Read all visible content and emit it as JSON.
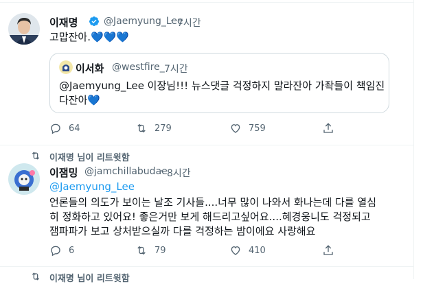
{
  "tweet1": {
    "name": "이재명",
    "handle": "@Jaemyung_Lee",
    "dot": "·",
    "time": "7시간",
    "text": "고맙잔아.💙💙💙",
    "quote": {
      "name": "이서화",
      "handle": "@westfire_",
      "dot": "·",
      "time": "7시간",
      "line1": "@Jaemyung_Lee 이장님!!! 뉴스댓글 걱정하지 말라잔아 가좍들이 책임진",
      "line2": "다잔아💙"
    },
    "actions": {
      "replies": "64",
      "retweets": "279",
      "likes": "759"
    }
  },
  "retweet_label_1": "이재명 님이 리트윗함",
  "tweet2": {
    "name": "이잼밍",
    "handle": "@jamchillabudae",
    "dot": "·",
    "time": "8시간",
    "mention": "@Jaemyung_Lee",
    "line1": "언론들의 의도가 보이는 날조 기사들....너무 많이 나와서 화나는데 다를 열심",
    "line2": "히 정화하고 있어요! 좋은거만 보게 해드리고싶어요....혜경웅니도 걱정되고",
    "line3": "잼파파가 보고 상처받으실까 다를 걱정하는 밤이에요 사랑해요",
    "actions": {
      "replies": "6",
      "retweets": "79",
      "likes": "410"
    }
  },
  "retweet_label_2": "이재명 님이 리트윗함",
  "colors": {
    "accent": "#1d9bf0",
    "muted": "#536471",
    "border": "#eff3f4"
  }
}
